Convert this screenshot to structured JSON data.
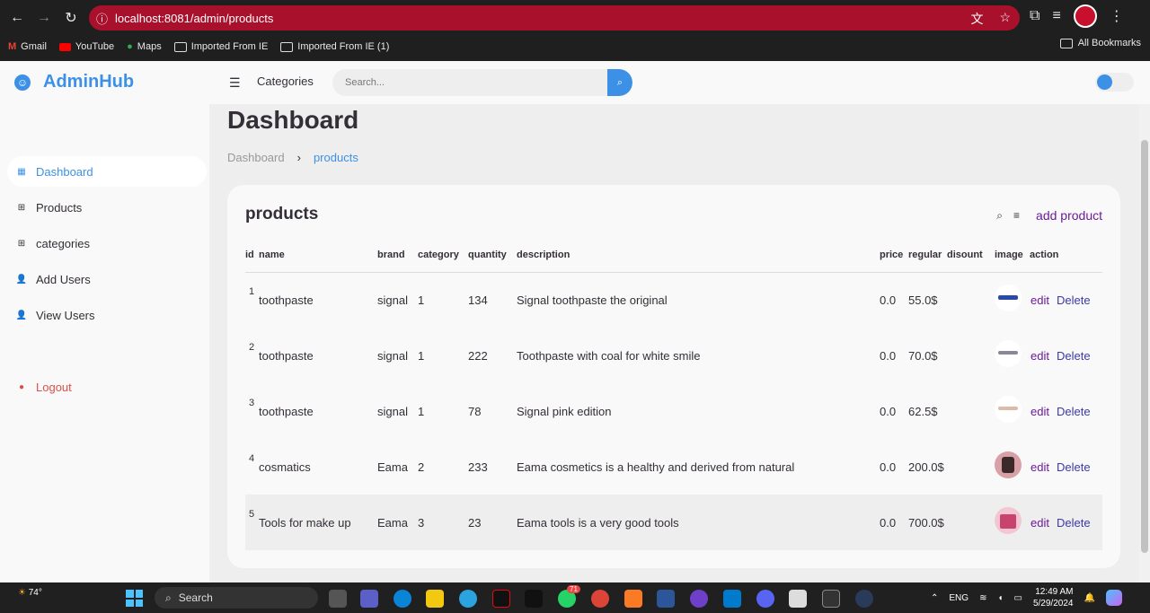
{
  "browser": {
    "url": "localhost:8081/admin/products",
    "bookmarks": [
      "Gmail",
      "YouTube",
      "Maps",
      "Imported From IE",
      "Imported From IE (1)"
    ],
    "all_bookmarks": "All Bookmarks"
  },
  "sidebar": {
    "brand": "AdminHub",
    "items": [
      {
        "label": "Dashboard",
        "icon": "dashboard-icon",
        "active": true
      },
      {
        "label": "Products",
        "icon": "plus-box-icon"
      },
      {
        "label": "categories",
        "icon": "plus-box-icon"
      },
      {
        "label": "Add Users",
        "icon": "add-user-icon"
      },
      {
        "label": "View Users",
        "icon": "user-icon"
      }
    ],
    "logout": "Logout"
  },
  "navbar": {
    "categories": "Categories",
    "search_placeholder": "Search..."
  },
  "main": {
    "title": "Dashboard",
    "breadcrumb": [
      "Dashboard",
      "products"
    ]
  },
  "products": {
    "title": "products",
    "add_label": "add product",
    "columns": [
      "id",
      "name",
      "brand",
      "category",
      "quantity",
      "description",
      "price",
      "regular",
      "disount",
      "image",
      "action"
    ],
    "rows": [
      {
        "id": "1",
        "name": "toothpaste",
        "brand": "signal",
        "category": "1",
        "quantity": "134",
        "description": "Signal toothpaste the original",
        "price": "0.0",
        "regular": "55.0$",
        "edit": "edit",
        "delete": "Delete"
      },
      {
        "id": "2",
        "name": "toothpaste",
        "brand": "signal",
        "category": "1",
        "quantity": "222",
        "description": "Toothpaste with coal for white smile",
        "price": "0.0",
        "regular": "70.0$",
        "edit": "edit",
        "delete": "Delete"
      },
      {
        "id": "3",
        "name": "toothpaste",
        "brand": "signal",
        "category": "1",
        "quantity": "78",
        "description": "Signal pink edition",
        "price": "0.0",
        "regular": "62.5$",
        "edit": "edit",
        "delete": "Delete"
      },
      {
        "id": "4",
        "name": "cosmatics",
        "brand": "Eama",
        "category": "2",
        "quantity": "233",
        "description": "Eama cosmetics is a healthy and derived from natural",
        "price": "0.0",
        "regular": "200.0$",
        "edit": "edit",
        "delete": "Delete"
      },
      {
        "id": "5",
        "name": "Tools for make up",
        "brand": "Eama",
        "category": "3",
        "quantity": "23",
        "description": "Eama tools is a very good tools",
        "price": "0.0",
        "regular": "700.0$",
        "edit": "edit",
        "delete": "Delete"
      }
    ]
  },
  "taskbar": {
    "weather": "74°",
    "search": "Search",
    "badge": "71",
    "lang": "ENG",
    "time": "12:49 AM",
    "date": "5/29/2024"
  },
  "colors": {
    "accent": "#3c91e6",
    "danger": "#db504a",
    "omnibox": "#a8102b"
  }
}
